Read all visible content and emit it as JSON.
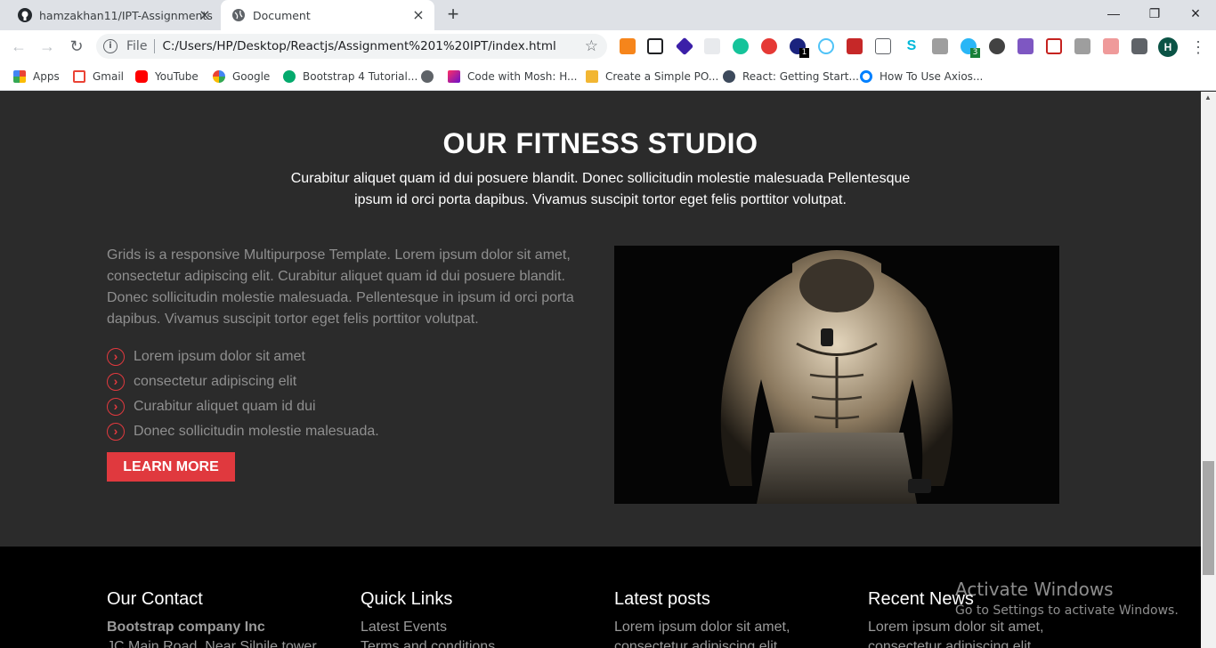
{
  "browser": {
    "tabs": [
      {
        "title": "hamzakhan11/IPT-Assignments",
        "active": false
      },
      {
        "title": "Document",
        "active": true
      }
    ],
    "address": {
      "scheme": "File",
      "url": "C:/Users/HP/Desktop/Reactjs/Assignment%201%20IPT/index.html"
    },
    "profile_initial": "H",
    "extension_badges": {
      "ext1": "1",
      "ext2": "3"
    },
    "bookmarks": [
      {
        "label": "Apps",
        "icon": "apps-grid-icon"
      },
      {
        "label": "Gmail",
        "icon": "gmail-icon"
      },
      {
        "label": "YouTube",
        "icon": "youtube-icon"
      },
      {
        "label": "Google",
        "icon": "google-icon"
      },
      {
        "label": "Bootstrap 4 Tutorial...",
        "icon": "bootstrap-tutorial-icon"
      },
      {
        "label": "",
        "icon": "globe-icon"
      },
      {
        "label": "Code with Mosh: H...",
        "icon": "mosh-icon"
      },
      {
        "label": "Create a Simple PO...",
        "icon": "codesnippet-icon"
      },
      {
        "label": "React: Getting Start...",
        "icon": "datacamp-icon"
      },
      {
        "label": "How To Use Axios...",
        "icon": "digitalocean-icon"
      }
    ]
  },
  "studio": {
    "title": "OUR FITNESS STUDIO",
    "subtitle": "Curabitur aliquet quam id dui posuere blandit. Donec sollicitudin molestie malesuada Pellentesque ipsum id orci porta dapibus. Vivamus suscipit tortor eget felis porttitor volutpat.",
    "intro": "Grids is a responsive Multipurpose Template. Lorem ipsum dolor sit amet, consectetur adipiscing elit. Curabitur aliquet quam id dui posuere blandit. Donec sollicitudin molestie malesuada. Pellentesque in ipsum id orci porta dapibus. Vivamus suscipit tortor eget felis porttitor volutpat.",
    "features": [
      "Lorem ipsum dolor sit amet",
      "consectetur adipiscing elit",
      "Curabitur aliquet quam id dui",
      "Donec sollicitudin molestie malesuada."
    ],
    "button_label": "LEARN MORE",
    "accent_color": "#e0393e"
  },
  "footer": {
    "contact": {
      "title": "Our Contact",
      "company": "Bootstrap company Inc",
      "address": "JC Main Road, Near Silnile tower"
    },
    "links": {
      "title": "Quick Links",
      "items": [
        "Latest Events",
        "Terms and conditions"
      ]
    },
    "posts": {
      "title": "Latest posts",
      "line1": "Lorem ipsum dolor sit amet,",
      "line2": "consectetur adipiscing elit"
    },
    "news": {
      "title": "Recent News",
      "line1": "Lorem ipsum dolor sit amet,",
      "line2": "consectetur adipiscing elit"
    }
  },
  "watermark": {
    "line1": "Activate Windows",
    "line2": "Go to Settings to activate Windows."
  }
}
